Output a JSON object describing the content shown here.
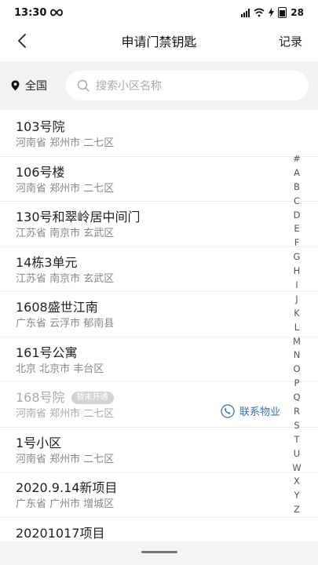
{
  "status": {
    "time": "13:30",
    "battery": "28"
  },
  "nav": {
    "title": "申请门禁钥匙",
    "right": "记录"
  },
  "search": {
    "location": "全国",
    "placeholder": "搜索小区名称"
  },
  "items": [
    {
      "name": "103号院",
      "address": "河南省 郑州市 二七区"
    },
    {
      "name": "106号楼",
      "address": "河南省 郑州市 二七区"
    },
    {
      "name": "130号和翠岭居中间门",
      "address": "江苏省 南京市 玄武区"
    },
    {
      "name": "14栋3单元",
      "address": "江苏省 南京市 玄武区"
    },
    {
      "name": "1608盛世江南",
      "address": "广东省 云浮市 郁南县"
    },
    {
      "name": "161号公寓",
      "address": "北京 北京市 丰台区"
    },
    {
      "name": "168号院",
      "address": "河南省 郑州市 二七区",
      "badge": "暂未开通",
      "contact": "联系物业"
    },
    {
      "name": "1号小区",
      "address": "河南省 郑州市 二七区"
    },
    {
      "name": "2020.9.14新项目",
      "address": "广东省 广州市 增城区"
    },
    {
      "name": "20201017项目",
      "address": ""
    }
  ],
  "index_letters": [
    "#",
    "A",
    "B",
    "C",
    "D",
    "E",
    "F",
    "G",
    "H",
    "I",
    "J",
    "K",
    "L",
    "M",
    "N",
    "O",
    "P",
    "Q",
    "R",
    "S",
    "T",
    "U",
    "W",
    "X",
    "Y",
    "Z"
  ]
}
